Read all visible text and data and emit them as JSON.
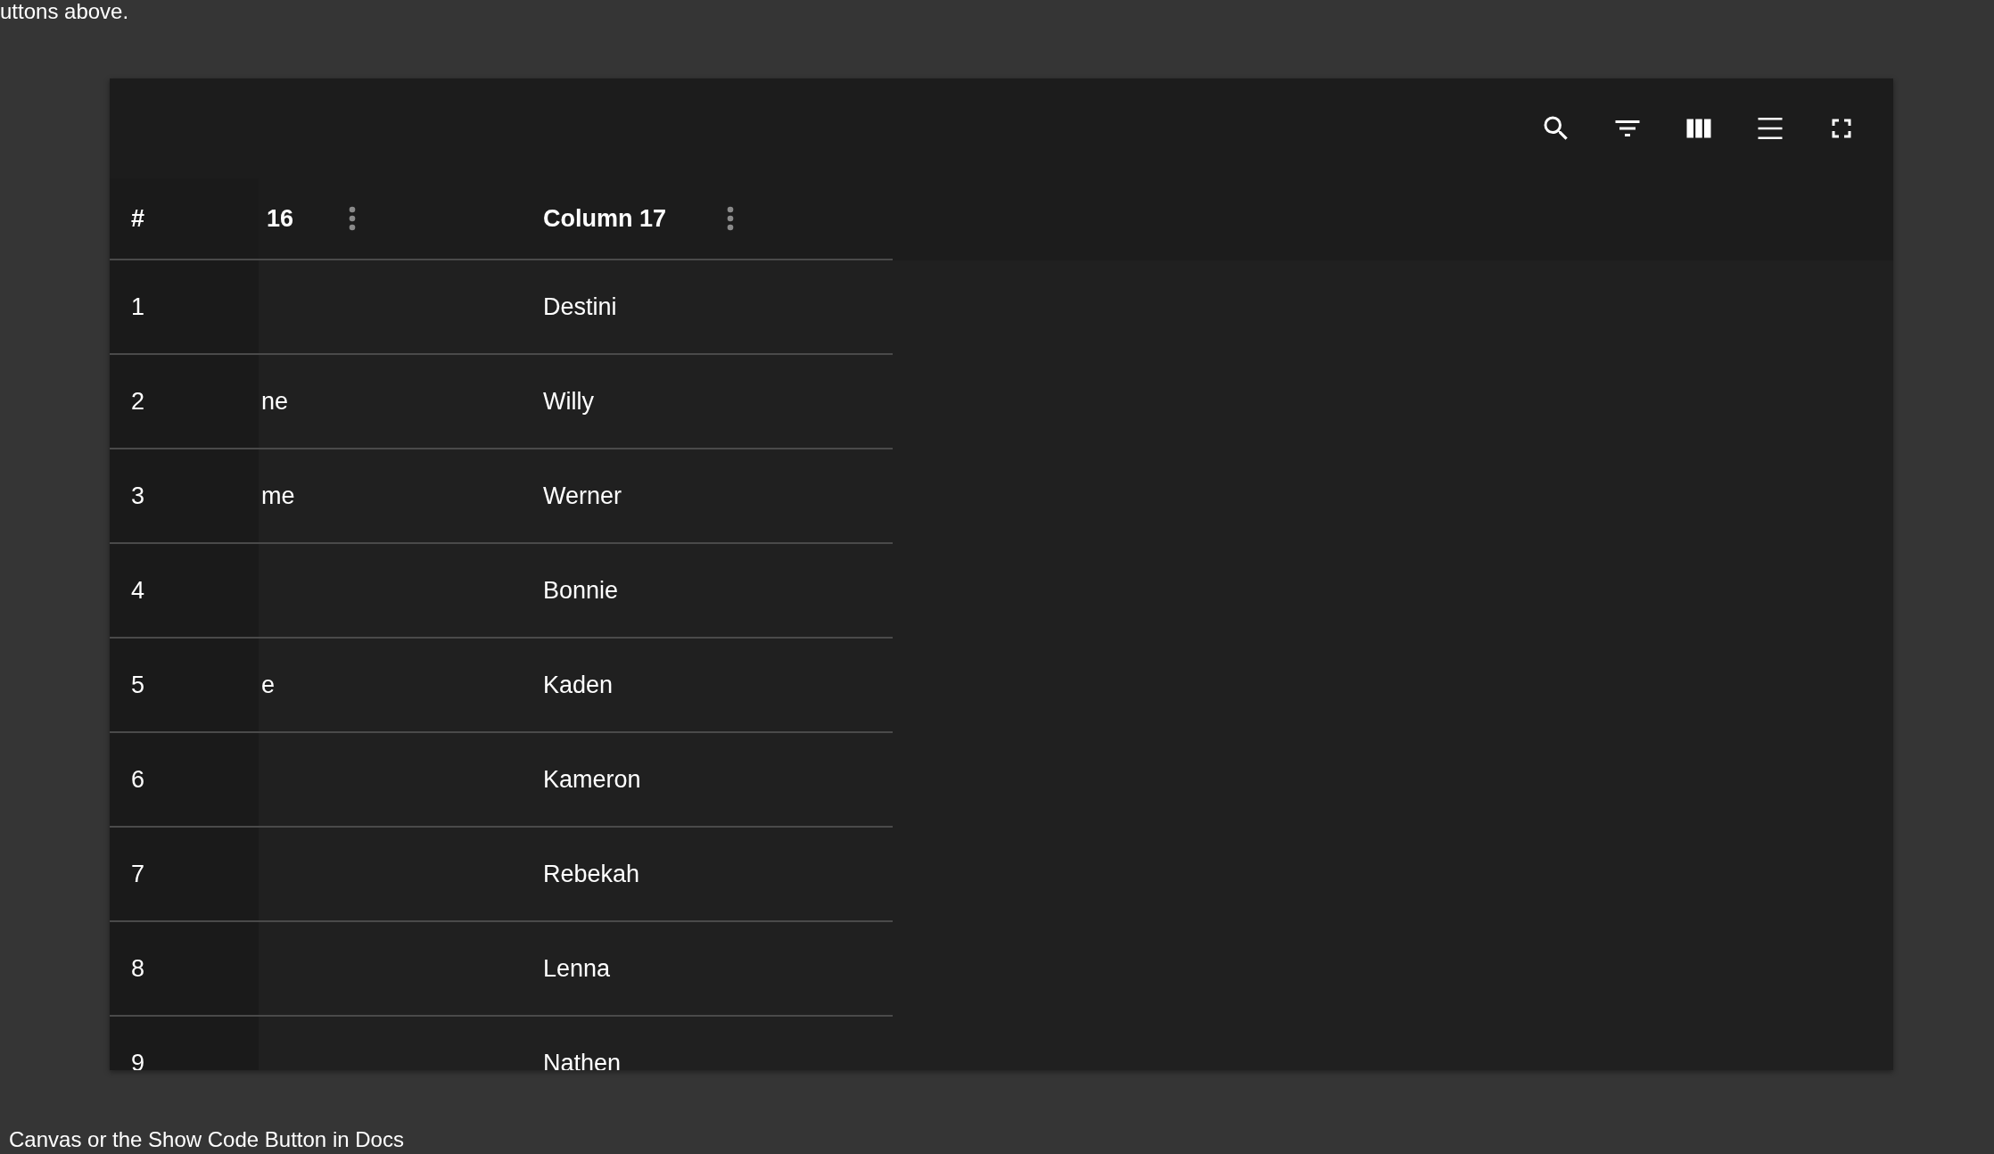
{
  "page_text": {
    "top": "uttons above.",
    "bottom": "Canvas or the Show Code Button in Docs"
  },
  "table": {
    "index_label": "#",
    "columns": [
      "16",
      "Column 17"
    ],
    "rows": [
      {
        "number": "1",
        "column_17": "Destini"
      },
      {
        "number": "2",
        "column_16": "ne",
        "column_17": "Willy"
      },
      {
        "number": "3",
        "column_16": "me",
        "column_17": "Werner"
      },
      {
        "number": "4",
        "column_17": "Bonnie"
      },
      {
        "number": "5",
        "column_16": "e",
        "column_17": "Kaden"
      },
      {
        "number": "6",
        "column_17": "Kameron"
      },
      {
        "number": "7",
        "column_17": "Rebekah"
      },
      {
        "number": "8",
        "column_17": "Lenna"
      },
      {
        "number": "9",
        "column_17": "Nathen"
      }
    ]
  }
}
